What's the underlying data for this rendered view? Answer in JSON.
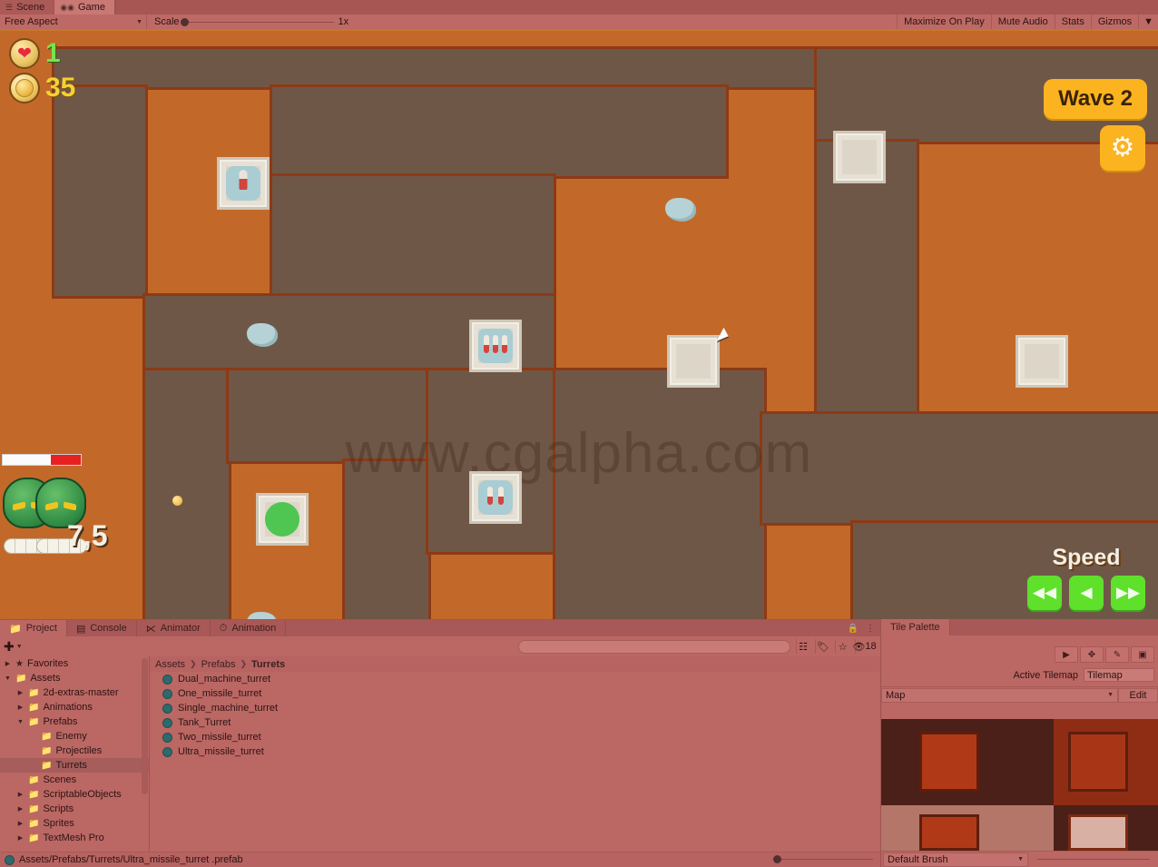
{
  "editor": {
    "view_tabs": [
      {
        "label": "Scene",
        "icon": "scene-icon",
        "active": false
      },
      {
        "label": "Game",
        "icon": "game-controller-icon",
        "active": true
      }
    ],
    "game_toolbar": {
      "aspect": "Free Aspect",
      "scale_label": "Scale",
      "scale_value": "1x",
      "right_buttons": [
        "Maximize On Play",
        "Mute Audio",
        "Stats",
        "Gizmos"
      ]
    }
  },
  "game": {
    "hud": {
      "lives": "1",
      "coins": "35",
      "wave_label": "Wave 2",
      "settings_icon": "gear-icon",
      "speed_label": "Speed",
      "speed_buttons": [
        "rewind-icon",
        "play-icon",
        "fast-forward-icon"
      ]
    },
    "enemy": {
      "damage_text": "7,5",
      "hp_percent": 62
    },
    "watermark": "www.cgalpha.com"
  },
  "project": {
    "tabs": [
      {
        "label": "Project",
        "icon": "folder-icon",
        "active": true
      },
      {
        "label": "Console",
        "icon": "console-icon",
        "active": false
      },
      {
        "label": "Animator",
        "icon": "animator-icon",
        "active": false
      },
      {
        "label": "Animation",
        "icon": "animation-icon",
        "active": false
      }
    ],
    "toolbar": {
      "add_label": "+",
      "search_placeholder": "",
      "count": "18"
    },
    "tree": [
      {
        "label": "Favorites",
        "depth": 0,
        "arrow": "▶",
        "icon": "star-icon",
        "selected": false
      },
      {
        "label": "Assets",
        "depth": 0,
        "arrow": "▼",
        "icon": "folder-open-icon",
        "selected": false
      },
      {
        "label": "2d-extras-master",
        "depth": 1,
        "arrow": "▶",
        "icon": "folder-icon",
        "selected": false
      },
      {
        "label": "Animations",
        "depth": 1,
        "arrow": "▶",
        "icon": "folder-icon",
        "selected": false
      },
      {
        "label": "Prefabs",
        "depth": 1,
        "arrow": "▼",
        "icon": "folder-open-icon",
        "selected": false
      },
      {
        "label": "Enemy",
        "depth": 2,
        "arrow": "",
        "icon": "folder-icon",
        "selected": false
      },
      {
        "label": "Projectiles",
        "depth": 2,
        "arrow": "",
        "icon": "folder-icon",
        "selected": false
      },
      {
        "label": "Turrets",
        "depth": 2,
        "arrow": "",
        "icon": "folder-icon",
        "selected": true
      },
      {
        "label": "Scenes",
        "depth": 1,
        "arrow": "",
        "icon": "folder-icon",
        "selected": false
      },
      {
        "label": "ScriptableObjects",
        "depth": 1,
        "arrow": "▶",
        "icon": "folder-icon",
        "selected": false
      },
      {
        "label": "Scripts",
        "depth": 1,
        "arrow": "▶",
        "icon": "folder-icon",
        "selected": false
      },
      {
        "label": "Sprites",
        "depth": 1,
        "arrow": "▶",
        "icon": "folder-icon",
        "selected": false
      },
      {
        "label": "TextMesh Pro",
        "depth": 1,
        "arrow": "▶",
        "icon": "folder-icon",
        "selected": false
      }
    ],
    "breadcrumb": [
      "Assets",
      "Prefabs",
      "Turrets"
    ],
    "assets": [
      "Dual_machine_turret",
      "One_missile_turret",
      "Single_machine_turret",
      "Tank_Turret",
      "Two_missile_turret",
      "Ultra_missile_turret"
    ],
    "status_path": "Assets/Prefabs/Turrets/Ultra_missile_turret .prefab"
  },
  "tile_palette": {
    "tab_label": "Tile Palette",
    "tools": [
      "select-icon",
      "move-icon",
      "brush-icon",
      "box-fill-icon"
    ],
    "active_tilemap_label": "Active Tilemap",
    "active_tilemap_value": "Tilemap",
    "map_value": "Map",
    "edit_label": "Edit",
    "brush_value": "Default Brush"
  }
}
